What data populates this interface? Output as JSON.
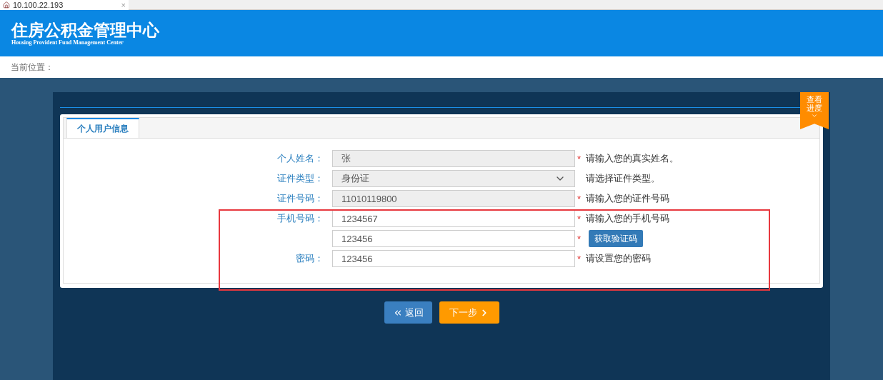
{
  "browser_tab": {
    "title": "10.100.22.193",
    "close": "×"
  },
  "header": {
    "title": "住房公积金管理中心",
    "subtitle": "Housing Provident Fund Management Center"
  },
  "breadcrumb": {
    "label": "当前位置："
  },
  "progress_ribbon": {
    "label": "查看进度"
  },
  "required_mark": "*",
  "tabs": [
    {
      "label": "个人用户信息",
      "selected": true
    }
  ],
  "form": [
    {
      "label": "个人姓名：",
      "kind": "text",
      "value": "张",
      "disabled": true,
      "required": true,
      "hint": "请输入您的真实姓名。"
    },
    {
      "label": "证件类型：",
      "kind": "select",
      "value": "身份证",
      "disabled": true,
      "required": false,
      "hint": "请选择证件类型。"
    },
    {
      "label": "证件号码：",
      "kind": "text",
      "value": "11010119800",
      "disabled": true,
      "required": true,
      "hint": "请输入您的证件号码"
    },
    {
      "label": "手机号码：",
      "kind": "text",
      "value": "1234567",
      "disabled": false,
      "required": true,
      "hint": "请输入您的手机号码"
    },
    {
      "kind": "code",
      "value": "123456",
      "disabled": false,
      "required": true,
      "button": "获取验证码"
    },
    {
      "label": "密码：",
      "kind": "text",
      "value": "123456",
      "disabled": false,
      "required": true,
      "hint": "请设置您的密码"
    }
  ],
  "buttons": [
    {
      "label": "返回",
      "kind": "back"
    },
    {
      "label": "下一步",
      "kind": "next"
    }
  ]
}
